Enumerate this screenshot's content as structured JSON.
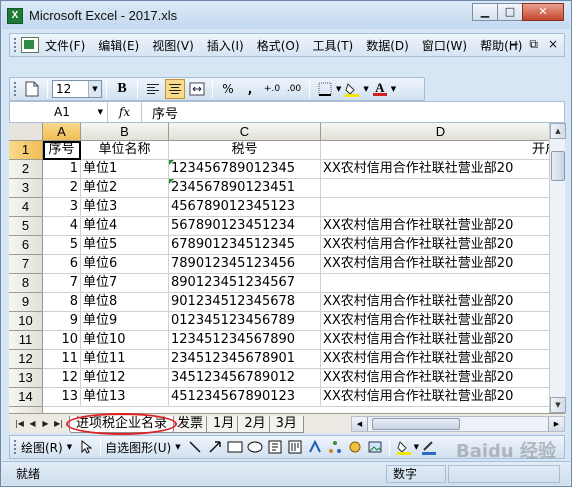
{
  "window": {
    "title": "Microsoft Excel - 2017.xls",
    "app_icon": "excel-icon",
    "controls": [
      "minimize",
      "maximize",
      "close"
    ]
  },
  "menubar": {
    "items": [
      "文件(F)",
      "编辑(E)",
      "视图(V)",
      "插入(I)",
      "格式(O)",
      "工具(T)",
      "数据(D)",
      "窗口(W)",
      "帮助(H)"
    ],
    "doc_controls": [
      "−",
      "⧉",
      "×"
    ]
  },
  "toolbar": {
    "font_size": "12",
    "bold_label": "B",
    "percent_label": "%",
    "comma_label": ",",
    "inc_decimal_label": "+.0",
    "dec_decimal_label": ".00",
    "font_color_label": "A",
    "colors": {
      "fill": "#f5e600",
      "font": "#d02020"
    }
  },
  "formula_bar": {
    "name_box": "A1",
    "fx_label": "fx",
    "content": "序号"
  },
  "columns": [
    "A",
    "B",
    "C",
    "D"
  ],
  "header_row": {
    "row": "1",
    "A": "序号",
    "B": "单位名称",
    "C": "税号",
    "D": "开户"
  },
  "rows": [
    {
      "row": "2",
      "A": "1",
      "B": "单位1",
      "C": "123456789012345",
      "D": "XX农村信用合作社联社营业部20",
      "tri": true
    },
    {
      "row": "3",
      "A": "2",
      "B": "单位2",
      "C": "234567890123451",
      "D": "",
      "tri": true
    },
    {
      "row": "4",
      "A": "3",
      "B": "单位3",
      "C": "456789012345123",
      "D": "",
      "tri": false
    },
    {
      "row": "5",
      "A": "4",
      "B": "单位4",
      "C": "567890123451234",
      "D": "XX农村信用合作社联社营业部20",
      "tri": false
    },
    {
      "row": "6",
      "A": "5",
      "B": "单位5",
      "C": "678901234512345",
      "D": "XX农村信用合作社联社营业部20",
      "tri": false
    },
    {
      "row": "7",
      "A": "6",
      "B": "单位6",
      "C": "789012345123456",
      "D": "XX农村信用合作社联社营业部20",
      "tri": false
    },
    {
      "row": "8",
      "A": "7",
      "B": "单位7",
      "C": "890123451234567",
      "D": "",
      "tri": false
    },
    {
      "row": "9",
      "A": "8",
      "B": "单位8",
      "C": "901234512345678",
      "D": "XX农村信用合作社联社营业部20",
      "tri": false
    },
    {
      "row": "10",
      "A": "9",
      "B": "单位9",
      "C": "012345123456789",
      "D": "XX农村信用合作社联社营业部20",
      "tri": false
    },
    {
      "row": "11",
      "A": "10",
      "B": "单位10",
      "C": "123451234567890",
      "D": "XX农村信用合作社联社营业部20",
      "tri": false
    },
    {
      "row": "12",
      "A": "11",
      "B": "单位11",
      "C": "234512345678901",
      "D": "XX农村信用合作社联社营业部20",
      "tri": false
    },
    {
      "row": "13",
      "A": "12",
      "B": "单位12",
      "C": "345123456789012",
      "D": "XX农村信用合作社联社营业部20",
      "tri": false
    },
    {
      "row": "14",
      "A": "13",
      "B": "单位13",
      "C": "451234567890123",
      "D": "XX农村信用合作社联社营业部20",
      "tri": false
    }
  ],
  "sheet_tabs": {
    "nav": [
      "|◀",
      "◀",
      "▶",
      "▶|"
    ],
    "tabs": [
      "进项税企业名录",
      "发票",
      "1月",
      "2月",
      "3月"
    ],
    "active": "进项税企业名录"
  },
  "drawing_toolbar": {
    "draw_label": "绘图(R)",
    "autoshapes_label": "自选图形(U)"
  },
  "statusbar": {
    "left": "就绪",
    "mode": "数字"
  },
  "watermark": "Baidu 经验"
}
